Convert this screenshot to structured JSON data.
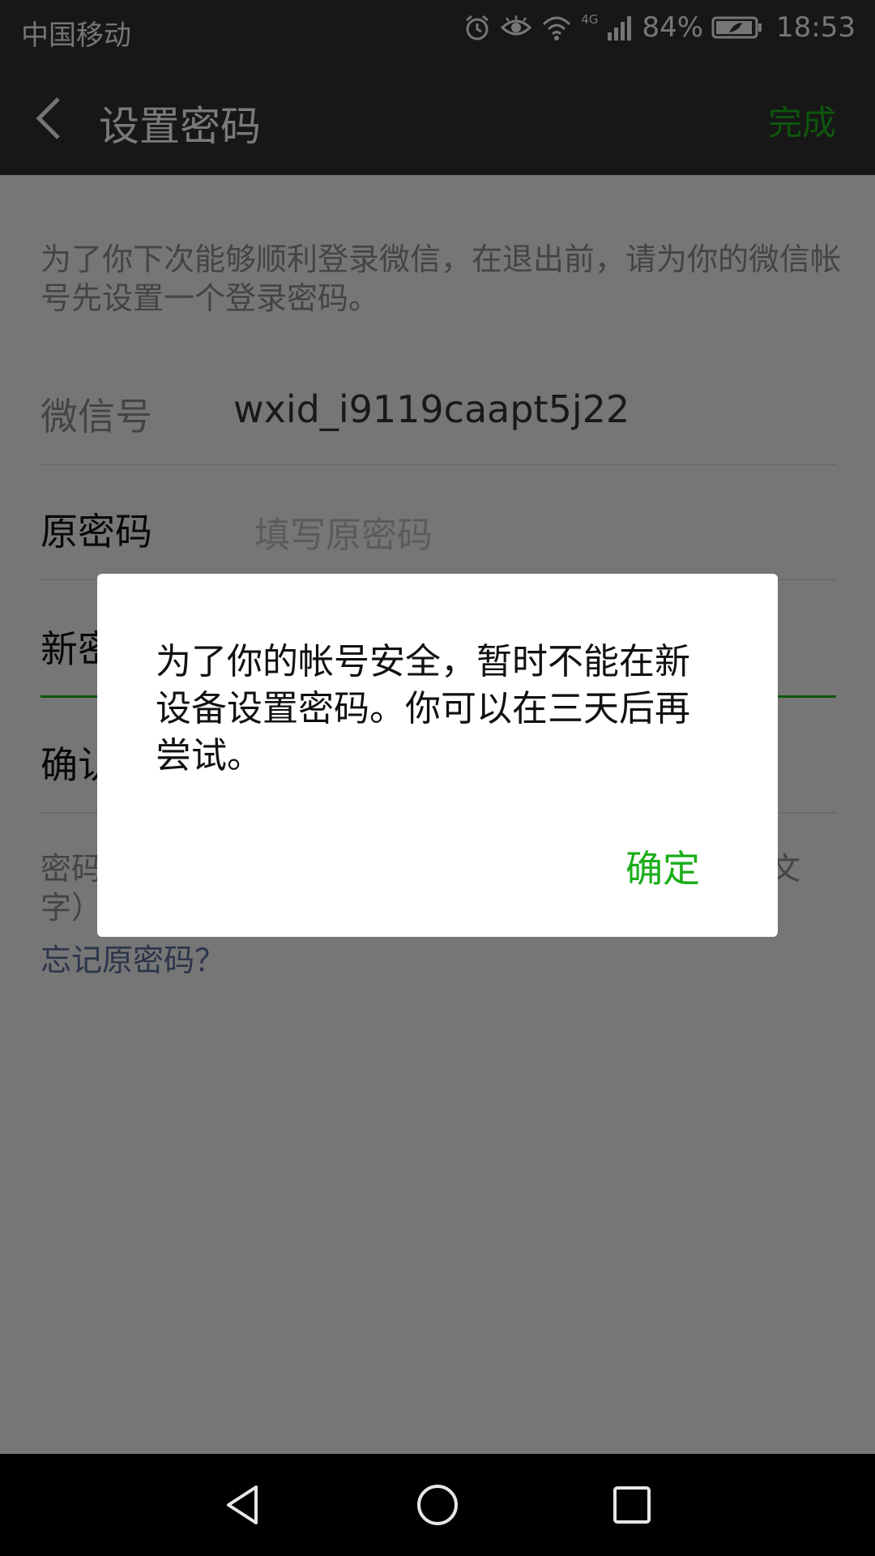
{
  "status_bar": {
    "carrier": "中国移动",
    "network": "4G",
    "battery_percent": "84%",
    "time": "18:53",
    "icons": [
      "alarm-icon",
      "eye-icon",
      "wifi-icon",
      "signal-icon",
      "battery-icon"
    ]
  },
  "title_bar": {
    "title": "设置密码",
    "done_label": "完成",
    "accent_color": "#1aad19"
  },
  "form": {
    "intro": "为了你下次能够顺利登录微信，在退出前，请为你的微信帐号先设置一个登录密码。",
    "wechat_id_label": "微信号",
    "wechat_id_value": "wxid_i9119caapt5j22",
    "old_password_label": "原密码",
    "old_password_placeholder": "填写原密码",
    "new_password_label": "新密",
    "confirm_password_label": "确认",
    "hint_line1_left": "密码",
    "hint_line1_right": "文",
    "hint_line2_left": "字）",
    "forgot_link": "忘记原密码？",
    "link_color": "#576b95"
  },
  "dialog": {
    "message": "为了你的帐号安全，暂时不能在新设备设置密码。你可以在三天后再尝试。",
    "ok_label": "确定"
  },
  "nav_bar": {
    "buttons": [
      "back-triangle-icon",
      "home-circle-icon",
      "recents-square-icon"
    ]
  }
}
